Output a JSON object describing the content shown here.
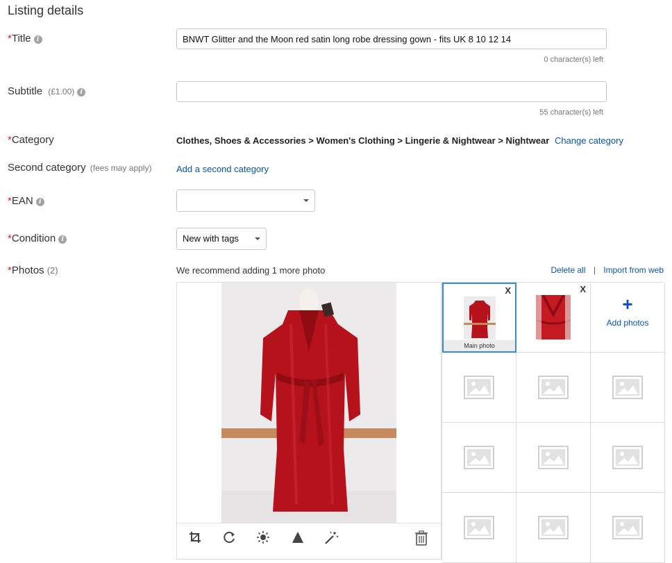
{
  "section_title": "Listing details",
  "title_field": {
    "required_mark": "*",
    "label": "Title",
    "value": "BNWT Glitter and the Moon red satin long robe dressing gown - fits UK 8 10 12 14",
    "counter": "0 character(s) left"
  },
  "subtitle_field": {
    "label": "Subtitle",
    "fee": "(£1.00)",
    "value": "",
    "counter": "55 character(s) left"
  },
  "category_field": {
    "required_mark": "*",
    "label": "Category",
    "path": "Clothes, Shoes & Accessories > Women's Clothing > Lingerie & Nightwear > Nightwear",
    "change_link": "Change category"
  },
  "second_category_field": {
    "label": "Second category",
    "note": "(fees may apply)",
    "link": "Add a second category"
  },
  "ean_field": {
    "required_mark": "*",
    "label": "EAN",
    "value": ""
  },
  "condition_field": {
    "required_mark": "*",
    "label": "Condition",
    "value": "New with tags"
  },
  "photos_field": {
    "required_mark": "*",
    "label": "Photos",
    "count": "(2)",
    "recommendation": "We recommend adding 1 more photo",
    "delete_all": "Delete all",
    "separator": "|",
    "import_web": "Import from web",
    "main_photo_caption": "Main photo",
    "remove_label": "X",
    "add_icon": "+",
    "add_photos": "Add photos"
  },
  "icons": [
    "info-icon",
    "chevron-down-icon",
    "crop-icon",
    "rotate-icon",
    "brightness-icon",
    "contrast-icon",
    "magic-wand-icon",
    "trash-icon",
    "image-placeholder-icon",
    "plus-icon"
  ],
  "colors": {
    "required": "#dd1e31",
    "link": "#0654ba",
    "selected_border": "#3a8cc6",
    "robe_red": "#b5121b"
  }
}
